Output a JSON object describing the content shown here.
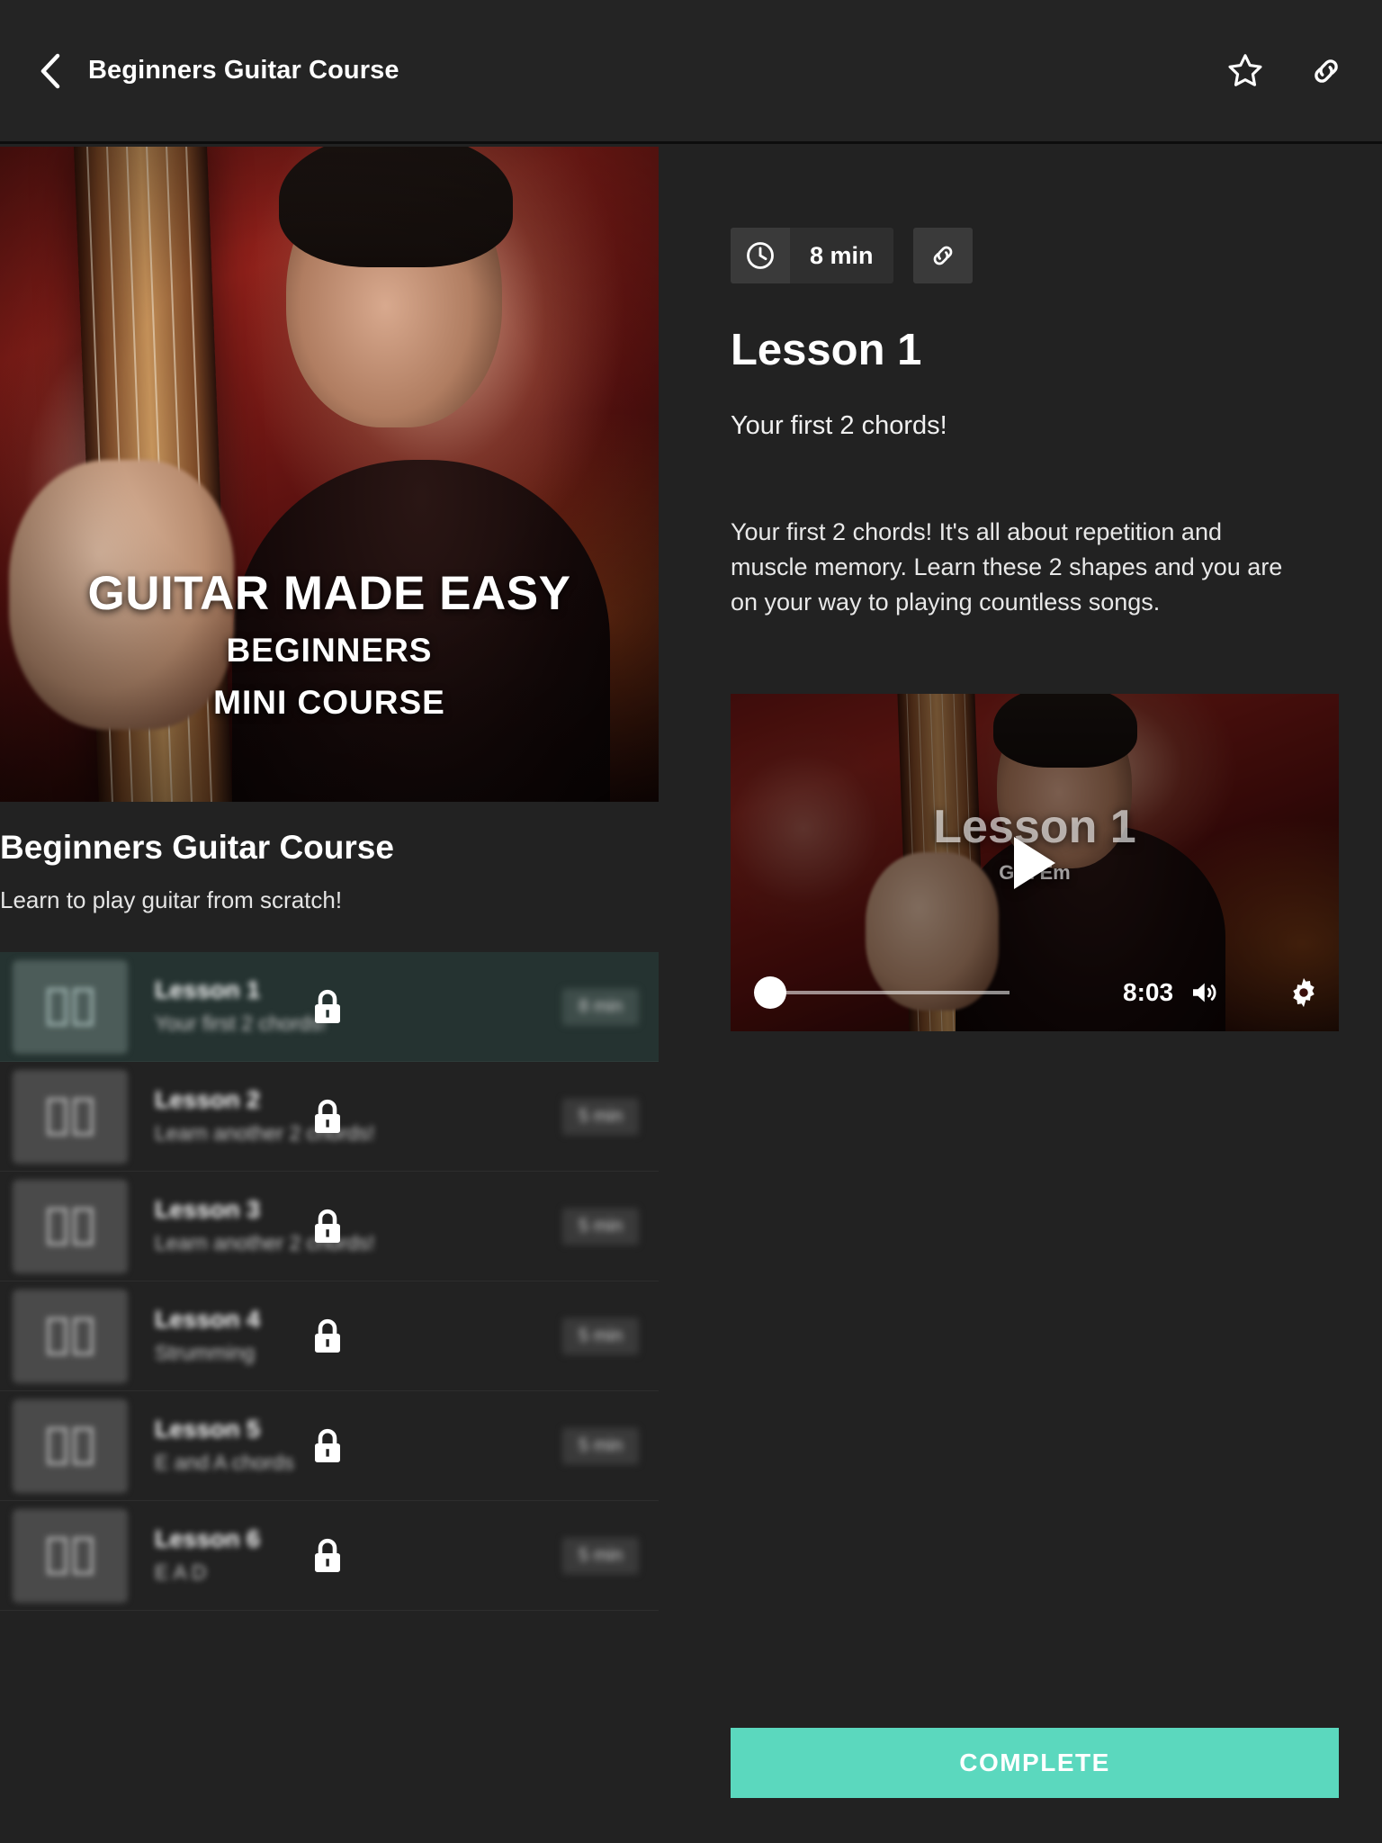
{
  "header": {
    "title": "Beginners Guitar Course",
    "back_icon": "chevron-left-icon",
    "favorite_icon": "star-outline-icon",
    "share_icon": "link-icon"
  },
  "course": {
    "hero": {
      "line1": "GUITAR MADE EASY",
      "line2": "BEGINNERS",
      "line3": "MINI COURSE"
    },
    "title": "Beginners Guitar Course",
    "subtitle": "Learn to play guitar from scratch!",
    "lessons": [
      {
        "name": "Lesson 1",
        "desc": "Your first 2 chords!",
        "duration": "8 min",
        "locked": true,
        "active": true
      },
      {
        "name": "Lesson 2",
        "desc": "Learn another 2 chords!",
        "duration": "5 min",
        "locked": true,
        "active": false
      },
      {
        "name": "Lesson 3",
        "desc": "Learn another 2 chords!",
        "duration": "5 min",
        "locked": true,
        "active": false
      },
      {
        "name": "Lesson 4",
        "desc": "Strumming",
        "duration": "5 min",
        "locked": true,
        "active": false
      },
      {
        "name": "Lesson 5",
        "desc": "E and A chords",
        "duration": "5 min",
        "locked": true,
        "active": false
      },
      {
        "name": "Lesson 6",
        "desc": "E A D",
        "duration": "5 min",
        "locked": true,
        "active": false
      }
    ]
  },
  "detail": {
    "duration": "8 min",
    "clock_icon": "clock-icon",
    "share_icon": "link-icon",
    "heading": "Lesson 1",
    "tagline": "Your first 2 chords!",
    "body": "Your first 2 chords! It's all about repetition and muscle memory. Learn these 2 shapes and you are on your way to playing countless songs.",
    "video": {
      "overlay_title": "Lesson 1",
      "overlay_subtitle": "G & Em",
      "play_icon": "play-icon",
      "time": "8:03",
      "volume_icon": "volume-icon",
      "settings_icon": "gear-icon",
      "fullscreen_icon": "fullscreen-icon"
    },
    "complete_label": "COMPLETE"
  },
  "colors": {
    "accent": "#5BD8BE",
    "background": "#222222",
    "header": "#242424",
    "active_row": "#253331"
  }
}
